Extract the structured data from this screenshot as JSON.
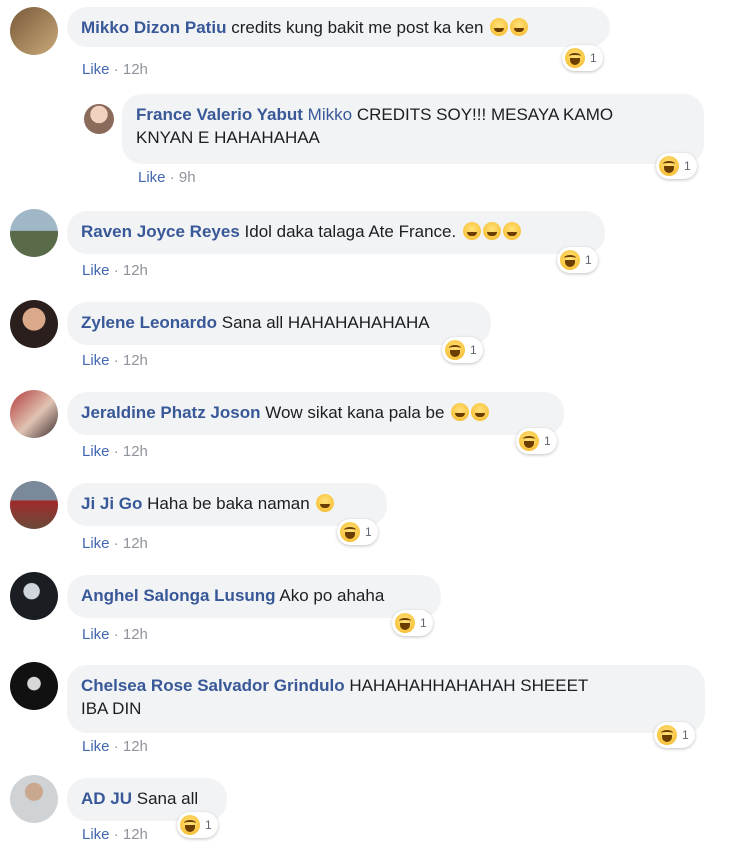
{
  "like_label": "Like",
  "separator": "·",
  "comments": [
    {
      "author": "Mikko Dizon Patiu",
      "mention": "",
      "text": "credits kung bakit me post ka ken",
      "time": "12h",
      "reactions": "1",
      "emoji_count": 2
    },
    {
      "author": "France Valerio Yabut",
      "mention": "Mikko",
      "text": "CREDITS SOY!!! MESAYA KAMO",
      "text2": "KNYAN E HAHAHAHAA",
      "time": "9h",
      "reactions": "1"
    },
    {
      "author": "Raven Joyce Reyes",
      "mention": "",
      "text": "Idol daka talaga Ate France.",
      "time": "12h",
      "reactions": "1",
      "emoji_count": 3
    },
    {
      "author": "Zylene Leonardo",
      "mention": "",
      "text": "Sana all HAHAHAHAHAHA",
      "time": "12h",
      "reactions": "1"
    },
    {
      "author": "Jeraldine Phatz Joson",
      "mention": "",
      "text": "Wow sikat kana pala be",
      "time": "12h",
      "reactions": "1",
      "emoji_count": 2
    },
    {
      "author": "Ji Ji Go",
      "mention": "",
      "text": "Haha be baka naman",
      "time": "12h",
      "reactions": "1",
      "emoji_count": 1
    },
    {
      "author": "Anghel Salonga Lusung",
      "mention": "",
      "text": "Ako po ahaha",
      "time": "12h",
      "reactions": "1"
    },
    {
      "author": "Chelsea Rose Salvador Grindulo",
      "mention": "",
      "text": "HAHAHAHHAHAHAH SHEEET",
      "text2": "IBA DIN",
      "time": "12h",
      "reactions": "1"
    },
    {
      "author": "AD JU",
      "mention": "",
      "text": "Sana all",
      "time": "12h",
      "reactions": "1"
    }
  ],
  "colors": {
    "author": "#385898",
    "bubble": "#f2f3f5",
    "meta": "#90949c",
    "like": "#4267b2"
  }
}
